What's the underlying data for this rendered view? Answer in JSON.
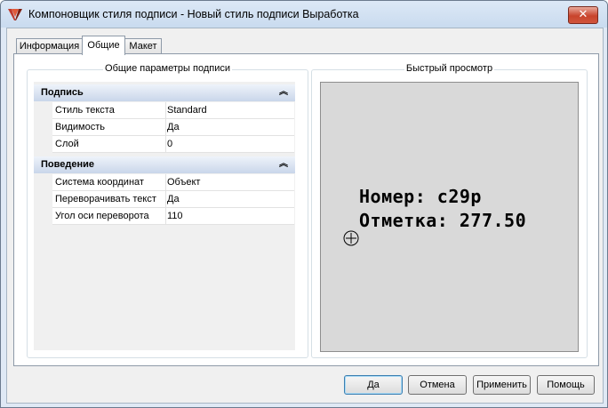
{
  "window": {
    "title": "Компоновщик стиля подписи - Новый стиль подписи Выработка",
    "close_symbol": "✕"
  },
  "tabs": [
    {
      "label": "Информация",
      "active": false
    },
    {
      "label": "Общие",
      "active": true
    },
    {
      "label": "Макет",
      "active": false
    }
  ],
  "general": {
    "title": "Общие параметры подписи",
    "categories": [
      {
        "label": "Подпись",
        "collapse_icon": "double-chevron-up-icon",
        "rows": [
          {
            "name": "Стиль текста",
            "value": "Standard"
          },
          {
            "name": "Видимость",
            "value": "Да"
          },
          {
            "name": "Слой",
            "value": "0"
          }
        ]
      },
      {
        "label": "Поведение",
        "collapse_icon": "double-chevron-up-icon",
        "rows": [
          {
            "name": "Система координат",
            "value": "Объект"
          },
          {
            "name": "Переворачивать текст",
            "value": "Да"
          },
          {
            "name": "Угол оси переворота",
            "value": "110"
          }
        ]
      }
    ]
  },
  "preview": {
    "title": "Быстрый просмотр",
    "line1": "Номер: c29p",
    "line2": "Отметка: 277.50"
  },
  "buttons": {
    "ok": "Да",
    "cancel": "Отмена",
    "apply": "Применить",
    "help": "Помощь"
  },
  "colors": {
    "title_bar": "#c9dbef",
    "close_button": "#c8442c",
    "category_header": "#c9d6ea",
    "preview_background": "#d9d9d9",
    "default_button_border": "#3c7fb1"
  }
}
